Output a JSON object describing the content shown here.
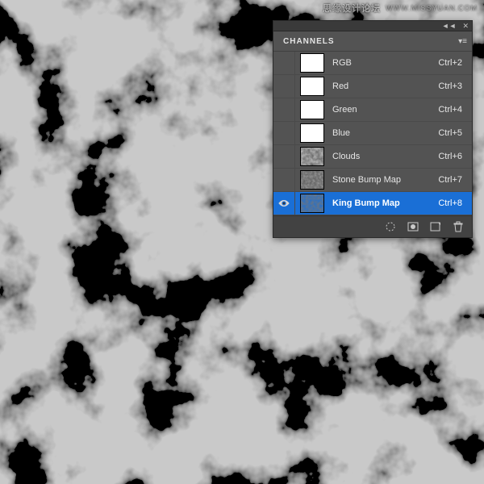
{
  "watermark": {
    "chinese": "思缘设计论坛",
    "url": "WWW.MISSYUAN.COM"
  },
  "panel": {
    "title": "CHANNELS",
    "collapse_glyph": "◄◄",
    "close_glyph": "✕",
    "menu_glyph": "▾≡",
    "channels": [
      {
        "name": "RGB",
        "shortcut": "Ctrl+2",
        "thumb": "white",
        "visible": false,
        "selected": false
      },
      {
        "name": "Red",
        "shortcut": "Ctrl+3",
        "thumb": "white",
        "visible": false,
        "selected": false
      },
      {
        "name": "Green",
        "shortcut": "Ctrl+4",
        "thumb": "white",
        "visible": false,
        "selected": false
      },
      {
        "name": "Blue",
        "shortcut": "Ctrl+5",
        "thumb": "white",
        "visible": false,
        "selected": false
      },
      {
        "name": "Clouds",
        "shortcut": "Ctrl+6",
        "thumb": "clouds",
        "visible": false,
        "selected": false
      },
      {
        "name": "Stone Bump Map",
        "shortcut": "Ctrl+7",
        "thumb": "stone",
        "visible": false,
        "selected": false
      },
      {
        "name": "King Bump Map",
        "shortcut": "Ctrl+8",
        "thumb": "king",
        "visible": true,
        "selected": true
      }
    ],
    "footer_icons": [
      "load-selection-icon",
      "save-selection-icon",
      "new-channel-icon",
      "delete-channel-icon"
    ]
  }
}
